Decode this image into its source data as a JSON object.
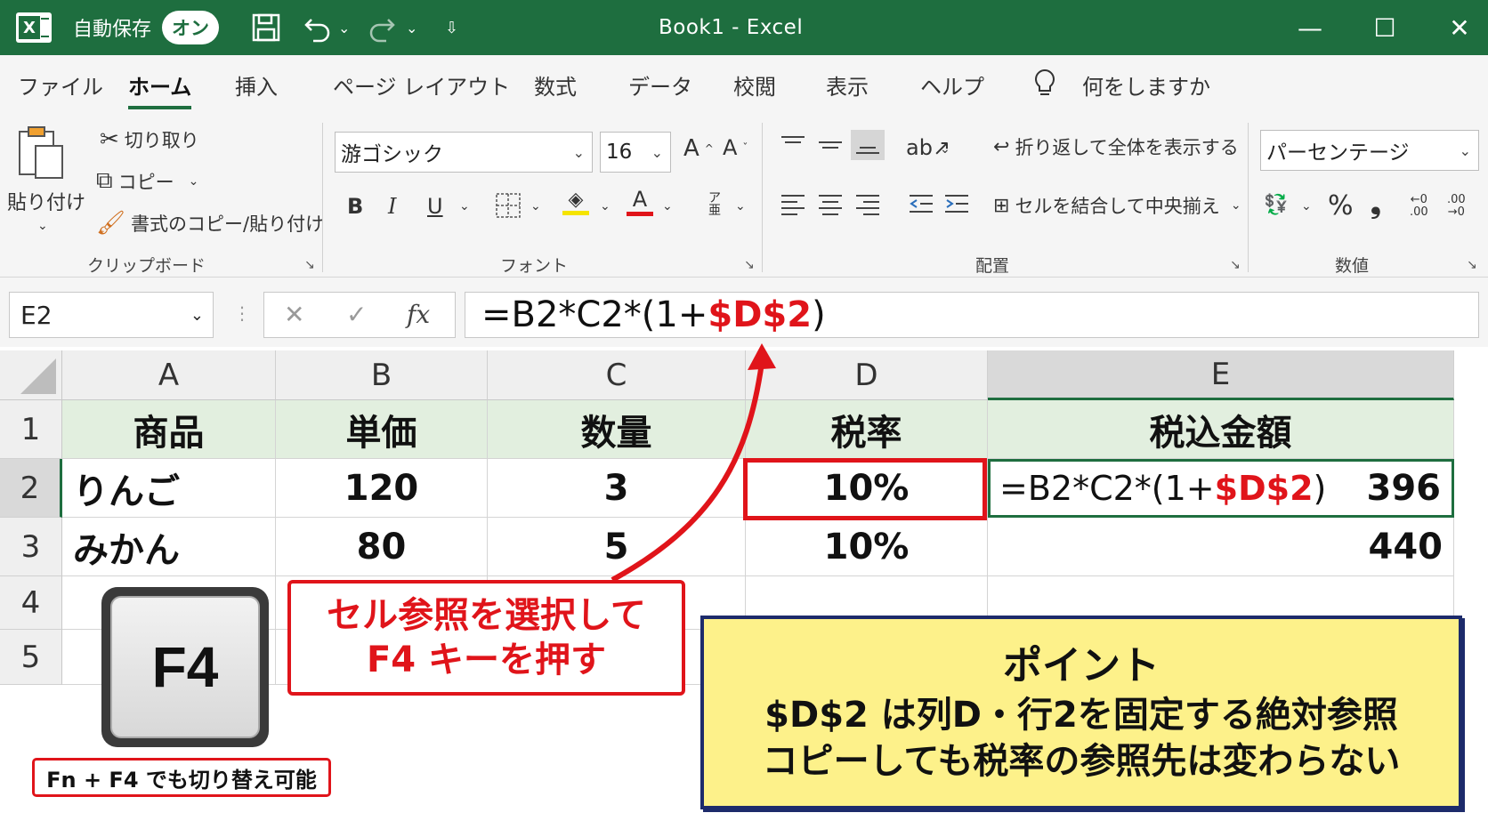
{
  "titlebar": {
    "autosave_label": "自動保存",
    "autosave_toggle": "オン",
    "doc_title": "Book1  -  Excel",
    "minimize": "—",
    "maximize": "☐",
    "close": "✕"
  },
  "menu": {
    "tabs": [
      "ファイル",
      "ホーム",
      "挿入",
      "ページ レイアウト",
      "数式",
      "データ",
      "校閲",
      "表示",
      "ヘルプ",
      "何をしますか"
    ],
    "active": "ホーム"
  },
  "ribbon": {
    "clipboard": {
      "paste_label": "貼り付け",
      "cut_label": "切り取り",
      "copy_label": "コピー",
      "format_painter_label": "書式のコピー/貼り付け",
      "group_label": "クリップボード"
    },
    "font": {
      "font_name": "游ゴシック",
      "font_size": "16",
      "group_label": "フォント"
    },
    "alignment": {
      "wrap_text_label": "折り返して全体を表示する",
      "merge_center_label": "セルを結合して中央揃え",
      "group_label": "配置"
    },
    "number": {
      "format": "パーセンテージ",
      "group_label": "数値"
    }
  },
  "formula_bar": {
    "name_box": "E2",
    "formula_prefix": "=B2*C2*(1+",
    "formula_ref": "$D$2",
    "formula_suffix": ")"
  },
  "sheet": {
    "columns": [
      "A",
      "B",
      "C",
      "D",
      "E"
    ],
    "rows": [
      "1",
      "2",
      "3",
      "4",
      "5"
    ],
    "headers": [
      "商品",
      "単価",
      "数量",
      "税率",
      "税込金額"
    ],
    "data": [
      {
        "product": "りんご",
        "price": "120",
        "qty": "3",
        "tax": "10%",
        "total": "396"
      },
      {
        "product": "みかん",
        "price": "80",
        "qty": "5",
        "tax": "10%",
        "total": "440"
      }
    ],
    "e2_formula_prefix": "=B2*C2*(1+",
    "e2_formula_ref": "$D$2",
    "e2_formula_suffix": ")"
  },
  "annotations": {
    "callout_line1": "セル参照を選択して",
    "callout_line2": "F4 キーを押す",
    "key_label": "F4",
    "key_note": "Fn + F4 でも切り替え可能",
    "point_title": "ポイント",
    "point_line1": "$D$2 は列D・行2を固定する絶対参照",
    "point_line2": "コピーしても税率の参照先は変わらない"
  },
  "colors": {
    "excel_green": "#1e6e3f",
    "header_fill": "#e2efdf",
    "highlight_red": "#e0141a",
    "point_fill": "#fdf18a",
    "point_border": "#1d2b6b"
  }
}
